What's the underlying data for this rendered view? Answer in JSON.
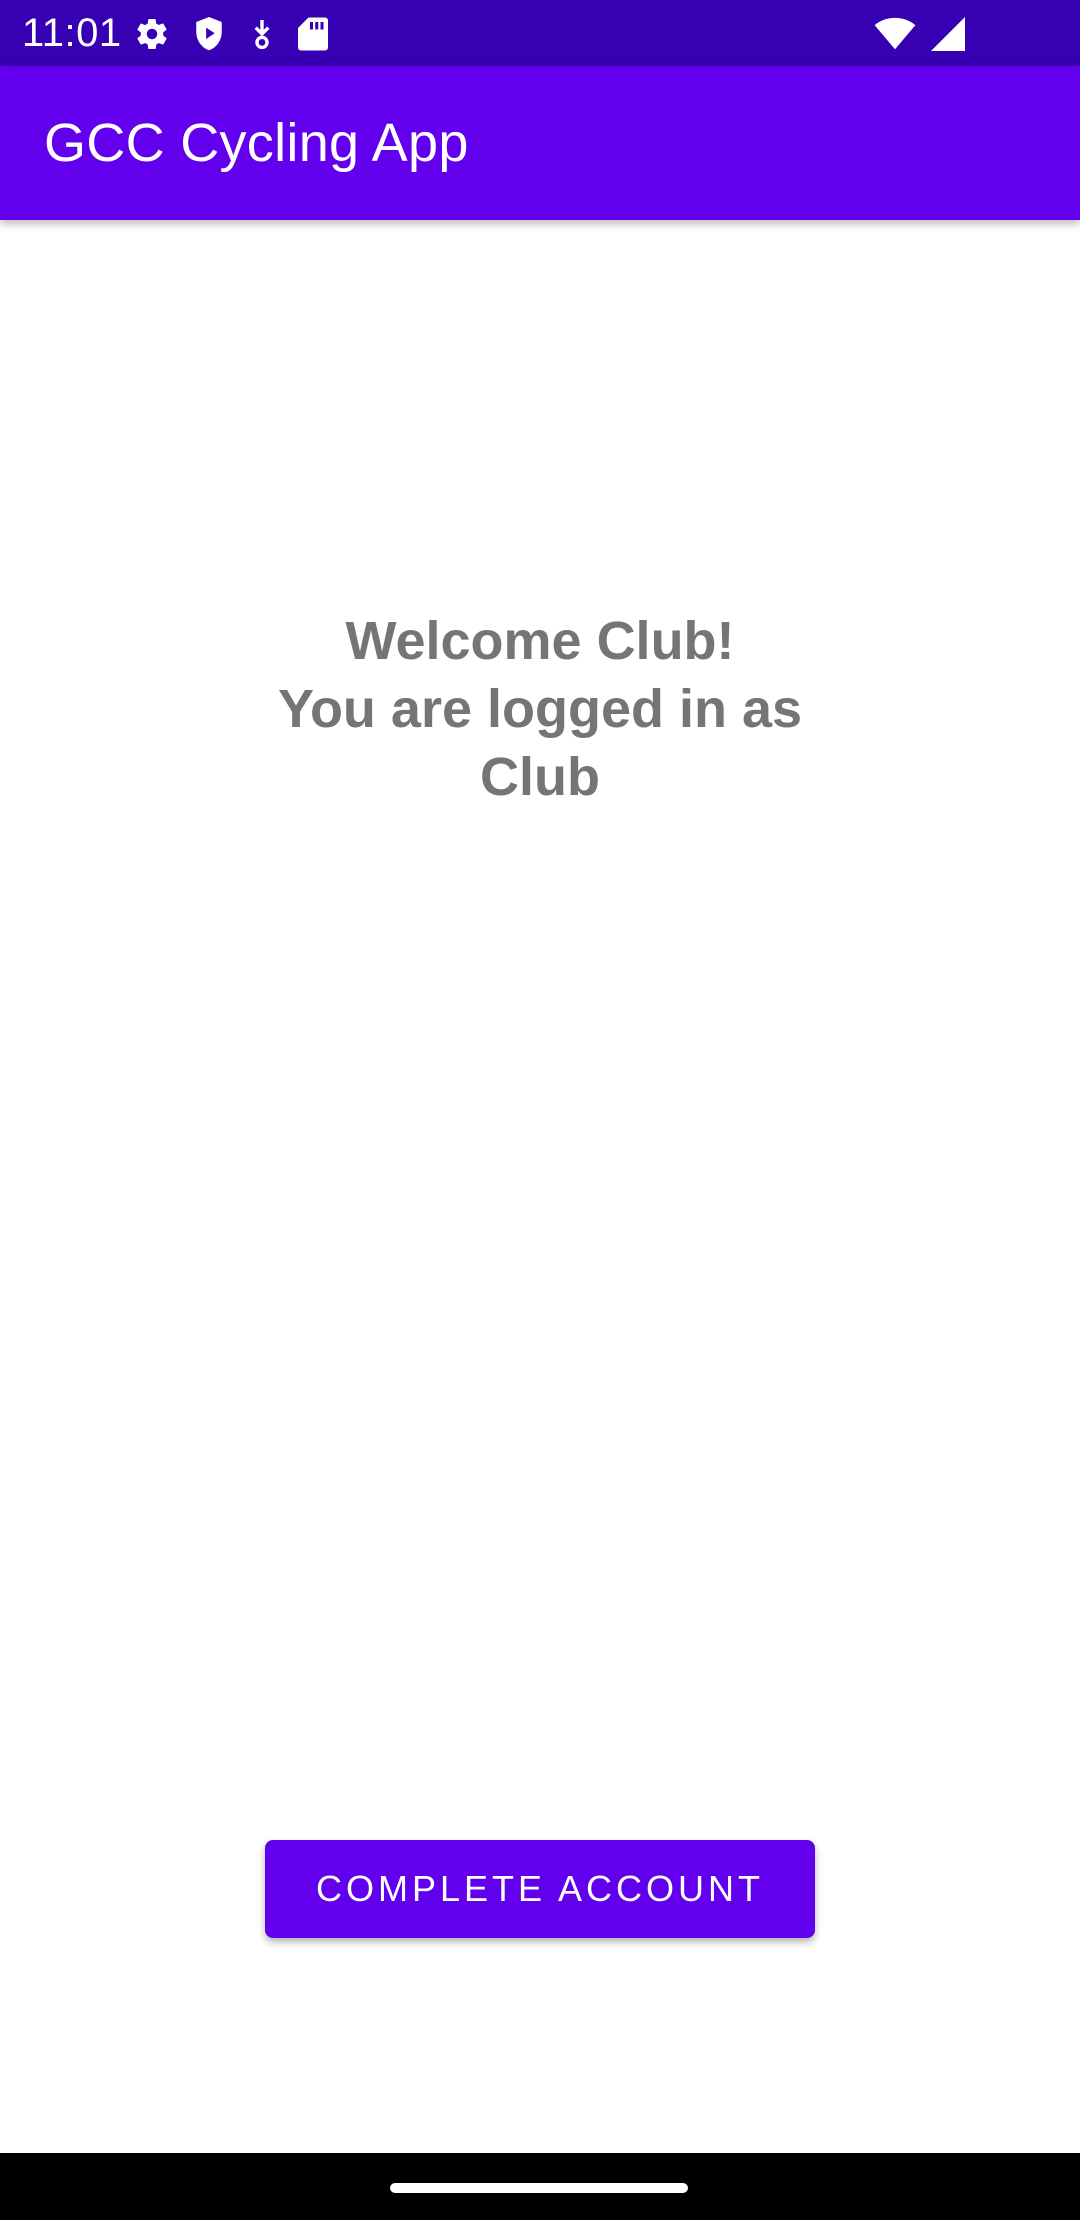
{
  "status_bar": {
    "time": "11:01",
    "icons_left": [
      "settings-icon",
      "play-protect-icon",
      "download-icon",
      "sd-card-icon"
    ],
    "icons_right": [
      "wifi-icon",
      "cell-signal-icon"
    ],
    "background": "#3700B3"
  },
  "app_bar": {
    "title": "GCC Cycling App",
    "background": "#6200EE"
  },
  "main": {
    "welcome_line_1": "Welcome Club!",
    "welcome_line_2": "You are logged in as",
    "welcome_line_3": "Club",
    "text_color": "#757575"
  },
  "actions": {
    "complete_account_label": "COMPLETE ACCOUNT",
    "button_color": "#6200EE"
  },
  "nav_bar": {
    "background": "#000000"
  }
}
